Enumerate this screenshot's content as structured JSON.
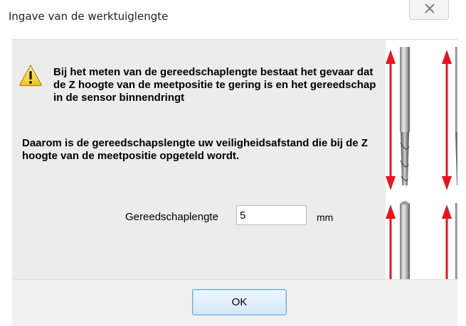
{
  "window": {
    "title": "Ingave van de werktuiglengte"
  },
  "icons": {
    "warning": "warning-triangle-icon",
    "close": "close-x-icon"
  },
  "messages": {
    "warning_text": "Bij het meten van de gereedschaplengte bestaat het gevaar dat de Z hoogte van de meetpositie te gering is en het gereedschap in de sensor binnendringt",
    "info_text": "Daarom is de gereedschapslengte uw veiligheidsafstand die bij de Z hoogte van de meetpositie opgeteld wordt."
  },
  "tool_length": {
    "label": "Gereedschaplengte",
    "value": "5",
    "unit": "mm"
  },
  "buttons": {
    "ok": "OK"
  },
  "colors": {
    "arrow_red": "#e8141c",
    "ok_border": "#5aa6e0",
    "dialog_bg": "#ececec"
  }
}
